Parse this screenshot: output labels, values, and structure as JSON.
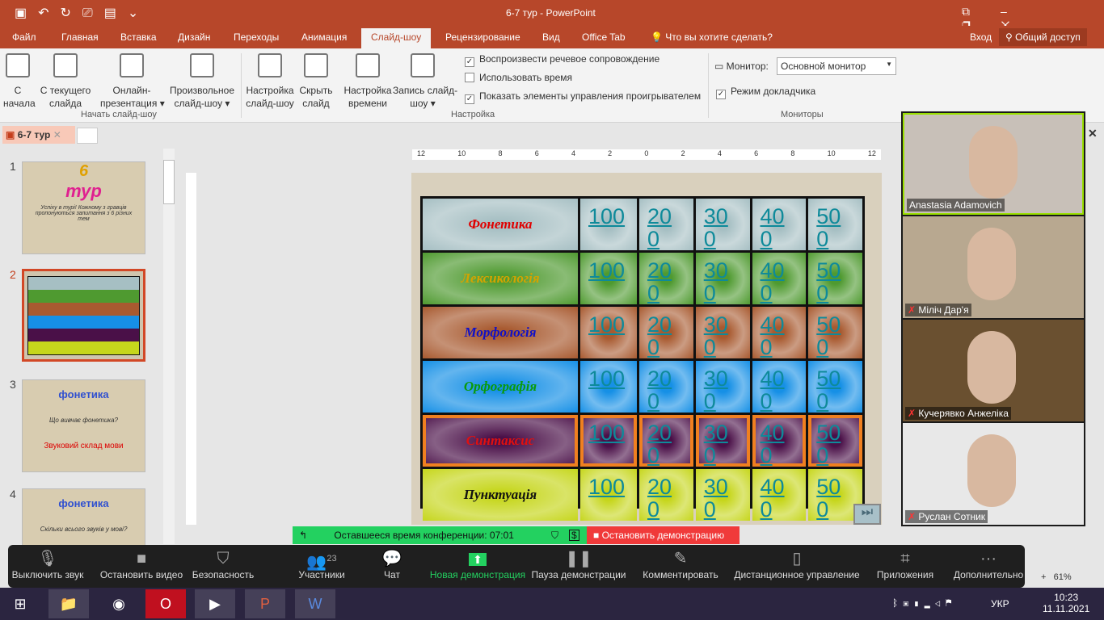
{
  "window": {
    "title": "6-7 тур - PowerPoint",
    "quick_access": [
      "save-icon",
      "undo-icon",
      "redo-icon",
      "present-icon",
      "layout-icon",
      "customize-icon"
    ]
  },
  "menu_tabs": [
    "Файл",
    "Главная",
    "Вставка",
    "Дизайн",
    "Переходы",
    "Анимация",
    "Слайд-шоу",
    "Рецензирование",
    "Вид",
    "Office Tab",
    "Что вы хотите сделать?"
  ],
  "active_tab": "Слайд-шоу",
  "account": {
    "signin": "Вход",
    "share": "Общий доступ"
  },
  "ribbon": {
    "buttons": [
      {
        "l1": "С",
        "l2": "начала"
      },
      {
        "l1": "С текущего",
        "l2": "слайда"
      },
      {
        "l1": "Онлайн-",
        "l2": "презентация ▾"
      },
      {
        "l1": "Произвольное",
        "l2": "слайд-шоу ▾"
      },
      {
        "l1": "Настройка",
        "l2": "слайд-шоу"
      },
      {
        "l1": "Скрыть",
        "l2": "слайд"
      },
      {
        "l1": "Настройка",
        "l2": "времени"
      },
      {
        "l1": "Запись слайд-",
        "l2": "шоу ▾"
      }
    ],
    "groups": [
      "Начать слайд-шоу",
      "Настройка",
      "Мониторы"
    ],
    "checks": [
      {
        "label": "Воспроизвести речевое сопровождение",
        "checked": true
      },
      {
        "label": "Использовать время",
        "checked": false
      },
      {
        "label": "Показать элементы управления проигрывателем",
        "checked": true
      }
    ],
    "monitor_label": "Монитор:",
    "monitor_value": "Основной монитор",
    "presenter_view": "Режим докладчика"
  },
  "doc_tab": "6-7 тур",
  "thumbnails": [
    "1",
    "2",
    "3",
    "4"
  ],
  "thumb_text": {
    "t1a": "6",
    "t1b": "тур",
    "t1c": "Успіху в турі! Кожному з гравців пропонуються запитання з 6 різних тем",
    "t3a": "фонетика",
    "t3b": "Що вивчає фонетика?",
    "t3c": "Звуковий склад мови",
    "t4a": "фонетика",
    "t4b": "Скільки всього звуків у мові?"
  },
  "ruler": [
    "12",
    "10",
    "8",
    "6",
    "4",
    "2",
    "0",
    "2",
    "4",
    "6",
    "8",
    "10",
    "12"
  ],
  "slide": {
    "categories": [
      {
        "name": "Фонетика",
        "color": "#e00000",
        "bg": "#a6bfc3"
      },
      {
        "name": "Лексикологія",
        "color": "#d4a300",
        "bg": "#4f9a30"
      },
      {
        "name": "Морфологія",
        "color": "#1010c8",
        "bg": "#a85a30"
      },
      {
        "name": "Орфографія",
        "color": "#0a9a0a",
        "bg": "#1690e6"
      },
      {
        "name": "Синтаксис",
        "color": "#e01010",
        "bg": "#4a1048"
      },
      {
        "name": "Пунктуація",
        "color": "#111111",
        "bg": "#c6d61c"
      }
    ],
    "values": [
      "100",
      "200",
      "300",
      "400",
      "500"
    ]
  },
  "participants": [
    {
      "name": "Anastasia Adamovich",
      "muted": false
    },
    {
      "name": "Міліч Дар'я",
      "muted": true
    },
    {
      "name": "Кучерявко Анжеліка",
      "muted": true
    },
    {
      "name": "Руслан Сотник",
      "muted": true
    }
  ],
  "meeting": {
    "remaining": "Оставшееся время конференции: 07:01",
    "stop": "Остановить демонстрацию"
  },
  "zoom_toolbar": [
    {
      "label": "Выключить звук",
      "icon": "mic-icon"
    },
    {
      "label": "Остановить видео",
      "icon": "video-icon"
    },
    {
      "label": "Безопасность",
      "icon": "shield-icon"
    },
    {
      "label": "Участники",
      "icon": "participants-icon",
      "count": "23"
    },
    {
      "label": "Чат",
      "icon": "chat-icon"
    },
    {
      "label": "Новая демонстрация",
      "icon": "share-icon"
    },
    {
      "label": "Пауза демонстрации",
      "icon": "pause-icon"
    },
    {
      "label": "Комментировать",
      "icon": "pen-icon"
    },
    {
      "label": "Дистанционное управление",
      "icon": "mouse-icon"
    },
    {
      "label": "Приложения",
      "icon": "apps-icon"
    },
    {
      "label": "Дополнительно",
      "icon": "more-icon"
    }
  ],
  "statusbar": {
    "zoom": "61%"
  },
  "taskbar": {
    "lang": "УКР",
    "time": "10:23",
    "date": "11.11.2021"
  },
  "colors": {
    "accent": "#b7472a",
    "green": "#23d160",
    "red": "#f03a3a"
  }
}
